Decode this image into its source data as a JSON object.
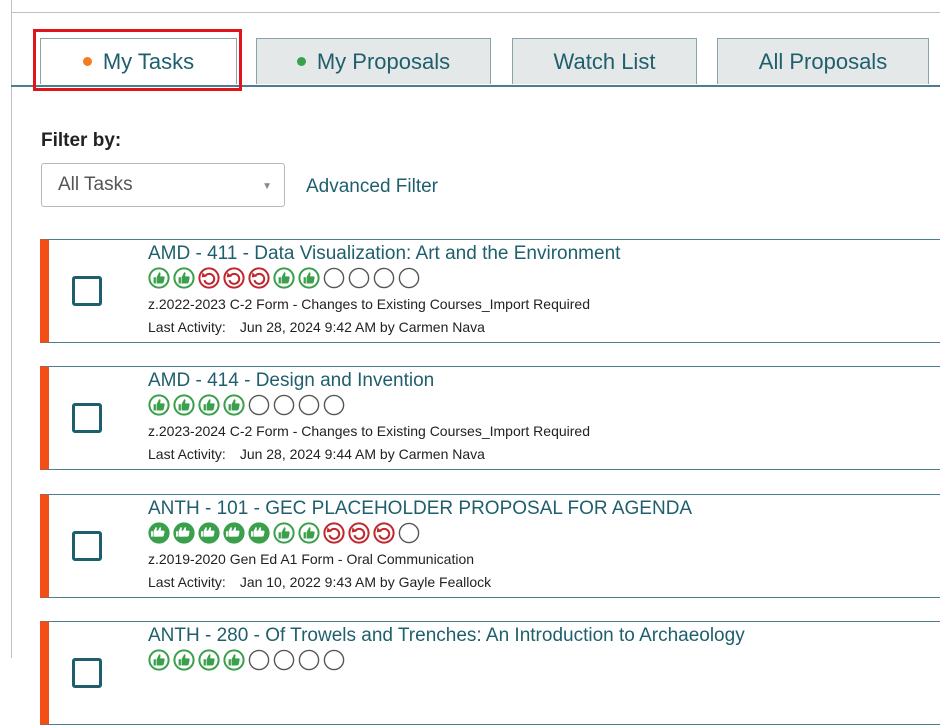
{
  "tabs": [
    {
      "label": "My Tasks",
      "dot_color": "#f47b20",
      "active": true
    },
    {
      "label": "My Proposals",
      "dot_color": "#3aa04b",
      "active": false
    },
    {
      "label": "Watch List",
      "active": false
    },
    {
      "label": "All Proposals",
      "active": false
    }
  ],
  "filter": {
    "label": "Filter by:",
    "selected": "All Tasks",
    "advanced_label": "Advanced Filter"
  },
  "activity_label": "Last Activity:",
  "colors": {
    "accent": "#1f5f6d",
    "card_stripe": "#f24e16",
    "approved": "#3aa04b",
    "rejected": "#c0282e",
    "highlight": "#e0151b"
  },
  "tasks": [
    {
      "title": "AMD - 411 - Data Visualization: Art and the Environment",
      "statuses": [
        "approve",
        "approve",
        "rollback",
        "rollback",
        "rollback",
        "approve",
        "approve",
        "pending",
        "pending",
        "pending",
        "pending"
      ],
      "form": "z.2022-2023 C-2 Form - Changes to Existing Courses_Import Required",
      "activity": "Jun 28, 2024 9:42 AM by Carmen Nava"
    },
    {
      "title": "AMD - 414 - Design and Invention",
      "statuses": [
        "approve",
        "approve",
        "approve",
        "approve",
        "pending",
        "pending",
        "pending",
        "pending"
      ],
      "form": "z.2023-2024 C-2 Form - Changes to Existing Courses_Import Required",
      "activity": "Jun 28, 2024 9:44 AM by Carmen Nava"
    },
    {
      "title": "ANTH - 101 - GEC PLACEHOLDER PROPOSAL FOR AGENDA",
      "statuses": [
        "multi",
        "multi",
        "multi",
        "multi",
        "multi",
        "approve",
        "approve",
        "rollback",
        "rollback",
        "rollback",
        "pending"
      ],
      "form": "z.2019-2020 Gen Ed A1 Form - Oral Communication",
      "activity": "Jan 10, 2022 9:43 AM by Gayle Feallock"
    },
    {
      "title": "ANTH - 280 - Of Trowels and Trenches: An Introduction to Archaeology",
      "statuses": [
        "approve",
        "approve",
        "approve",
        "approve",
        "pending",
        "pending",
        "pending",
        "pending"
      ],
      "form": "",
      "activity": ""
    }
  ]
}
